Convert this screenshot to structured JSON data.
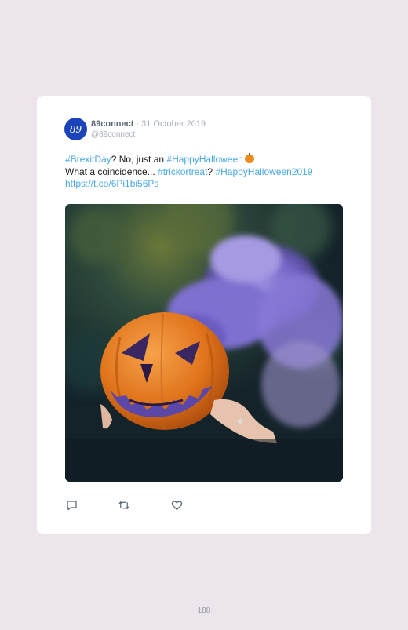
{
  "tweet": {
    "avatar_text": "89",
    "display_name": "89connect",
    "separator": "·",
    "date": "31 October 2019",
    "handle": "@89connect",
    "line1": {
      "tag1": "#BrexitDay",
      "text1": "? No, just an ",
      "tag2": "#HappyHalloween"
    },
    "line2": {
      "text1": "What a coincidence... ",
      "tag1": "#trickortreat",
      "text2": "? ",
      "tag2": "#HappyHalloween2019"
    },
    "line3": {
      "link": "https://t.co/6Pi1bi56Ps"
    },
    "emoji_name": "jack-o-lantern",
    "image_name": "pumpkin-smoke-photo"
  },
  "actions": [
    {
      "name": "reply-icon"
    },
    {
      "name": "retweet-icon"
    },
    {
      "name": "like-icon"
    }
  ],
  "colors": {
    "background": "#ece6ec",
    "hashtag": "#4aa8e6",
    "avatar": "#1a44b8",
    "display_name": "#5b6877",
    "muted": "#a9b0b8"
  },
  "page": {
    "number": "188"
  }
}
